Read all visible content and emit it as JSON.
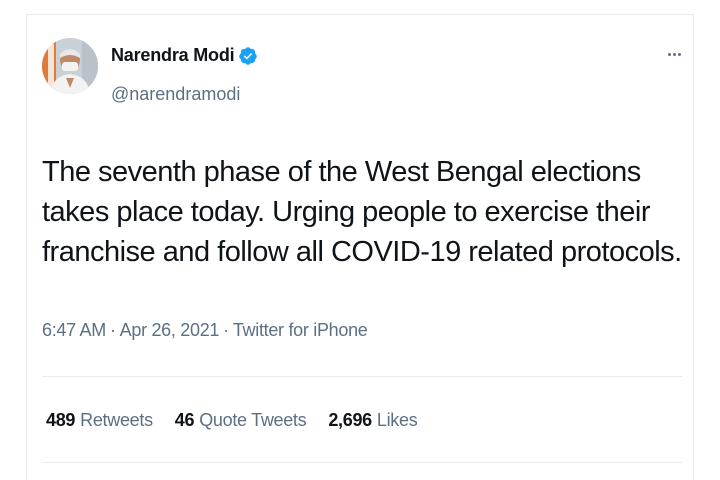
{
  "tweet": {
    "author_name": "Narendra Modi",
    "handle": "@narendramodi",
    "verified": true,
    "text": "The seventh phase of the West Bengal elections takes place today. Urging people to exercise their franchise and follow all COVID-19 related protocols.",
    "time": "6:47 AM",
    "date": "Apr 26, 2021",
    "source": "Twitter for iPhone",
    "separator": "·"
  },
  "stats": {
    "retweets_count": "489",
    "retweets_label": "Retweets",
    "quotes_count": "46",
    "quotes_label": "Quote Tweets",
    "likes_count": "2,696",
    "likes_label": "Likes"
  },
  "icons": {
    "verified": "verified-badge-icon",
    "more": "more-options-icon"
  },
  "colors": {
    "verified_blue": "#1da1f2",
    "secondary_text": "#5b7083",
    "primary_text": "#0f1419"
  }
}
